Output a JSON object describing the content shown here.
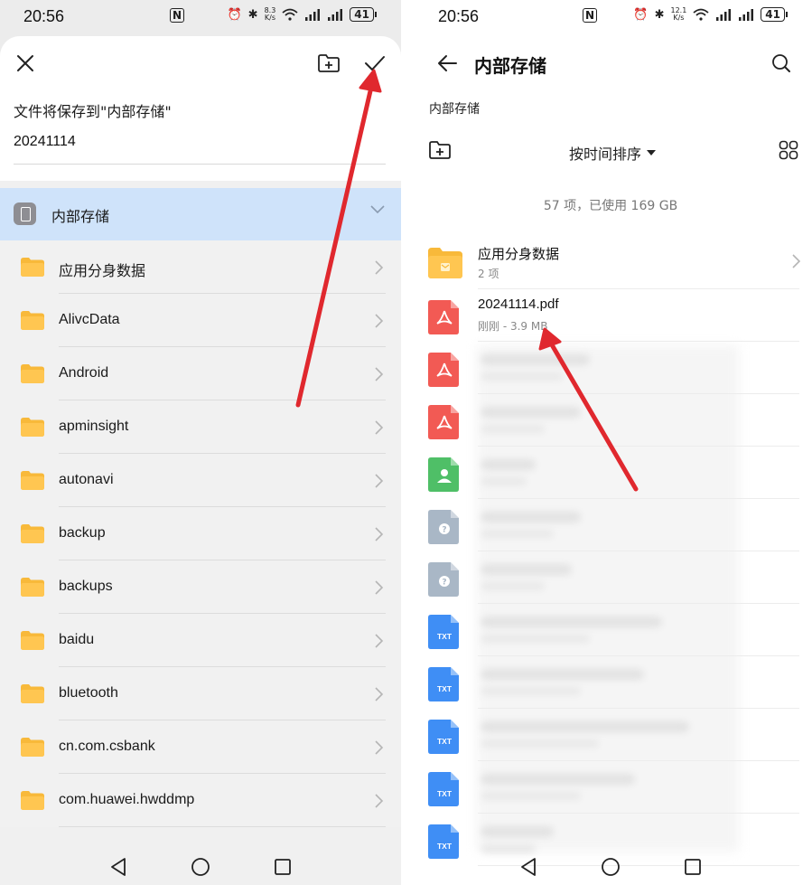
{
  "status_left": {
    "time": "20:56",
    "speed_top": "8.3",
    "speed_bottom": "K/s",
    "battery": "41"
  },
  "status_right": {
    "time": "20:56",
    "speed_top": "12.1",
    "speed_bottom": "K/s",
    "battery": "41"
  },
  "save_dialog": {
    "save_to_text": "文件将保存到\"内部存储\"",
    "filename": "20241114",
    "storage_label": "内部存储",
    "folders": [
      {
        "name": "应用分身数据"
      },
      {
        "name": "AlivcData"
      },
      {
        "name": "Android"
      },
      {
        "name": "apminsight"
      },
      {
        "name": "autonavi"
      },
      {
        "name": "backup"
      },
      {
        "name": "backups"
      },
      {
        "name": "baidu"
      },
      {
        "name": "bluetooth"
      },
      {
        "name": "cn.com.csbank"
      },
      {
        "name": "com.huawei.hwddmp"
      }
    ]
  },
  "file_browser": {
    "title": "内部存储",
    "breadcrumb": "内部存储",
    "sort_label": "按时间排序",
    "summary": "57 项，已使用 169 GB",
    "items": [
      {
        "type": "folder",
        "name": "应用分身数据",
        "meta": "2 项"
      },
      {
        "type": "pdf",
        "name": "20241114.pdf",
        "meta": "刚刚 - 3.9 MB"
      },
      {
        "type": "pdf"
      },
      {
        "type": "pdf"
      },
      {
        "type": "contact"
      },
      {
        "type": "unknown"
      },
      {
        "type": "unknown"
      },
      {
        "type": "txt",
        "badge": "TXT"
      },
      {
        "type": "txt",
        "badge": "TXT"
      },
      {
        "type": "txt",
        "badge": "TXT"
      },
      {
        "type": "txt",
        "badge": "TXT"
      },
      {
        "type": "txt",
        "badge": "TXT"
      }
    ]
  },
  "colors": {
    "accent_arrow": "#e0282e",
    "selected_row": "#cfe3fa",
    "folder": "#f8b93a",
    "pdf": "#f25a54",
    "txt": "#3f8ef5",
    "contact": "#4fbf67",
    "unknown": "#a9b7c6"
  },
  "icons": [
    "close-icon",
    "new-folder-icon",
    "check-icon",
    "back-arrow-icon",
    "search-icon",
    "grid-view-icon",
    "chevron-right-icon",
    "chevron-down-icon",
    "caret-down-icon",
    "folder-icon",
    "pdf-icon",
    "contact-file-icon",
    "unknown-file-icon",
    "txt-file-icon",
    "nav-back-icon",
    "nav-home-icon",
    "nav-recents-icon"
  ]
}
